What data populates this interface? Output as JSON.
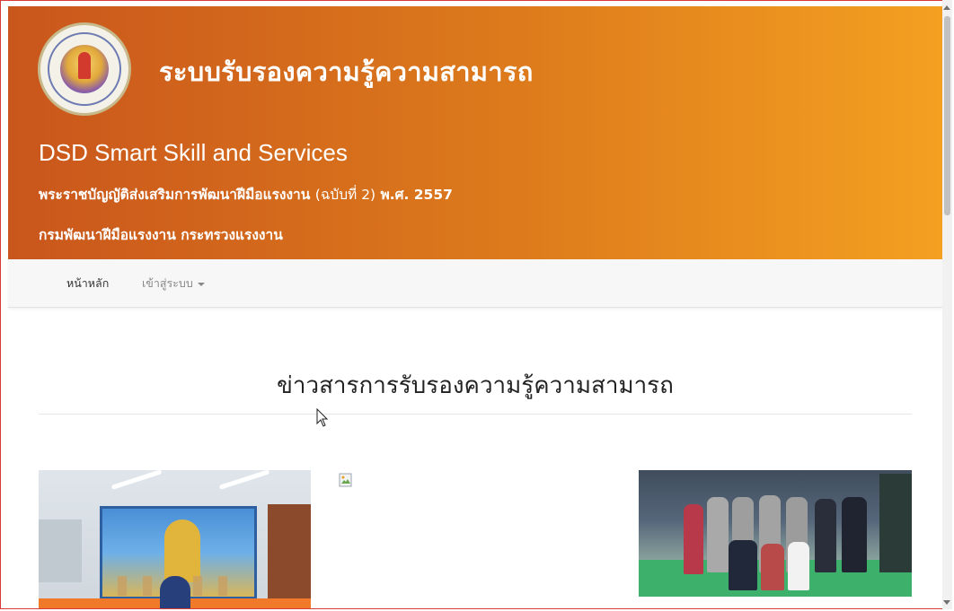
{
  "header": {
    "site_title": "ระบบรับรองความรู้ความสามารถ",
    "brand_name": "DSD Smart Skill and Services",
    "act_text": "พระราชบัญญัติส่งเสริมการพัฒนาฝีมือแรงงาน",
    "act_version": "(ฉบับที่ 2)",
    "act_year": "พ.ศ. 2557",
    "department": "กรมพัฒนาฝีมือแรงงาน กระทรวงแรงงาน",
    "colors": {
      "gradient_start": "#c9561c",
      "gradient_end": "#f4a021"
    }
  },
  "nav": {
    "home_label": "หน้าหลัก",
    "login_label": "เข้าสู่ระบบ"
  },
  "main": {
    "news_heading": "ข่าวสารการรับรองความรู้ความสามารถ",
    "images": [
      {
        "name": "news-photo-meeting",
        "icon": "photo"
      },
      {
        "name": "news-photo-broken",
        "icon": "broken-image-icon"
      },
      {
        "name": "news-photo-group",
        "icon": "photo"
      }
    ]
  },
  "icons": {
    "seal": "department-seal-logo",
    "cursor": "mouse-cursor-icon",
    "caret": "caret-down-icon"
  }
}
